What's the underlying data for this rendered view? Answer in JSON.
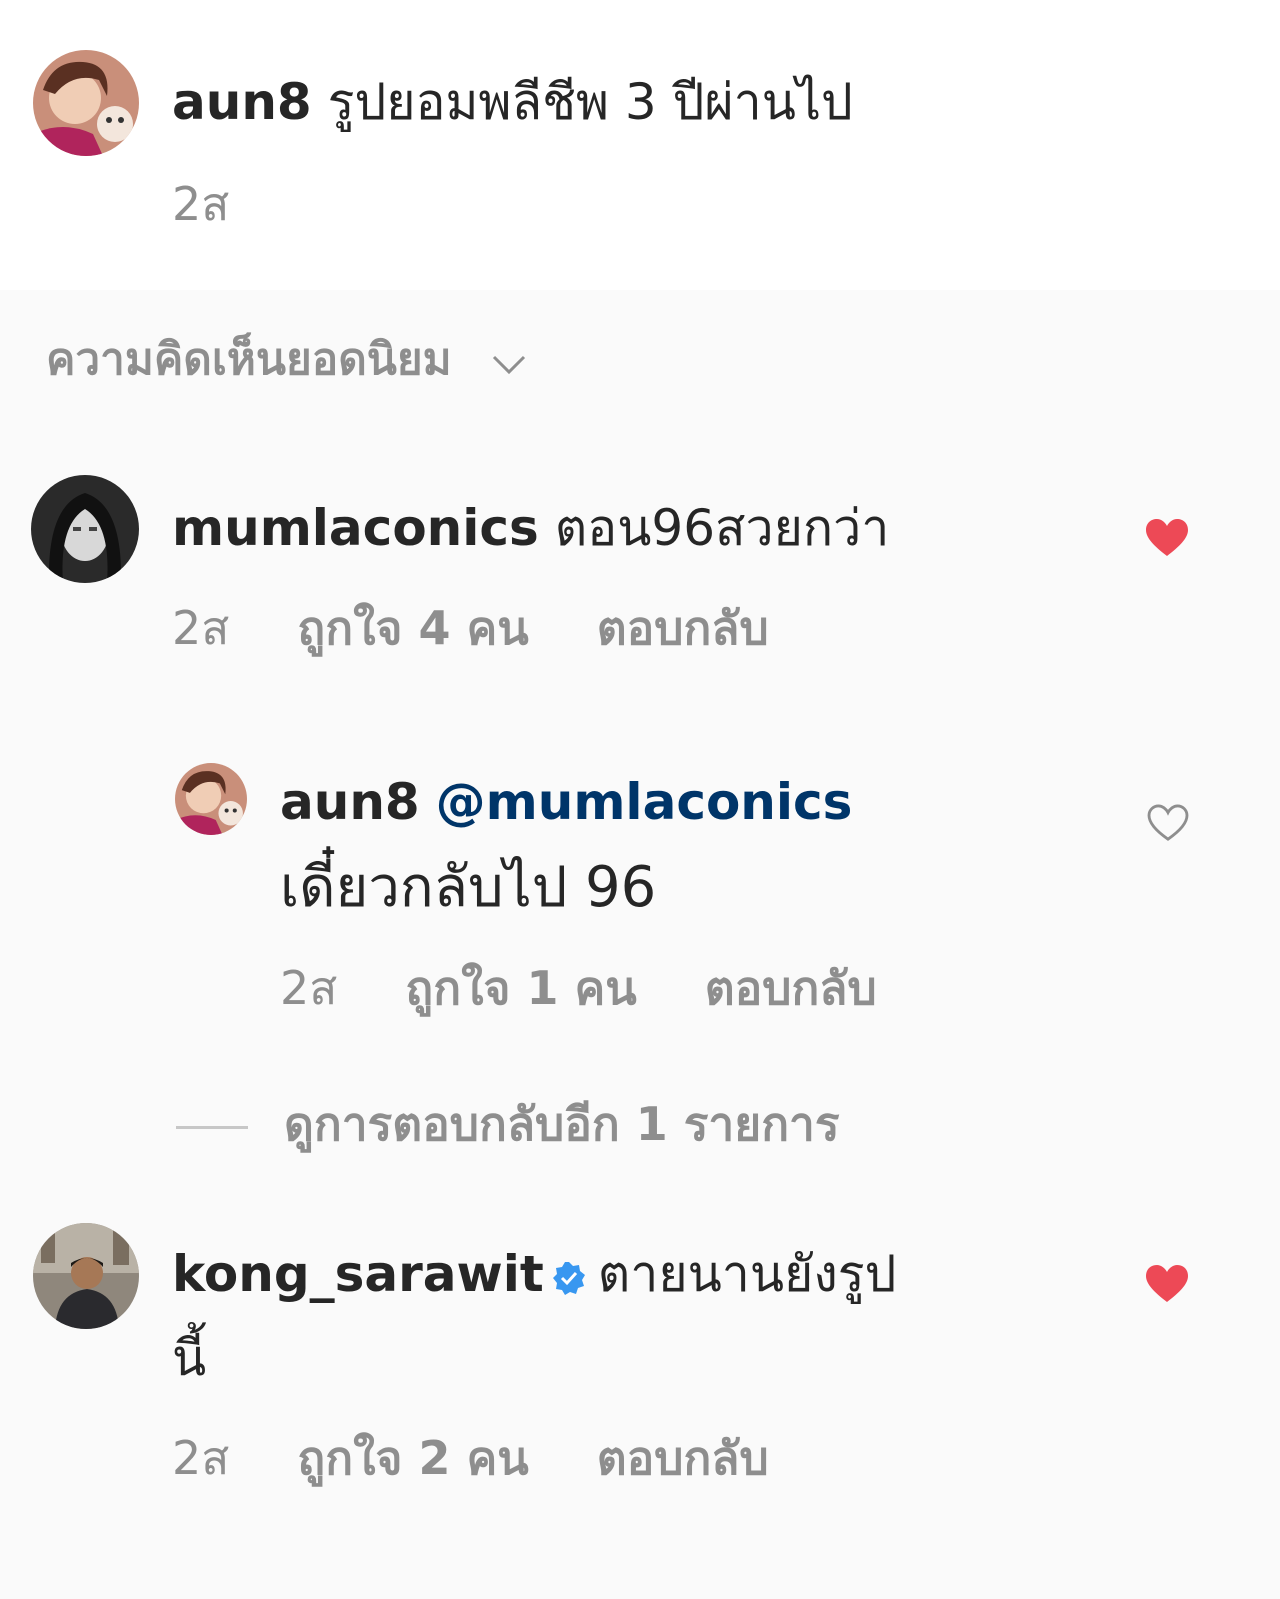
{
  "caption": {
    "username": "aun8",
    "text": "รูปยอมพลีชีพ 3 ปีผ่านไป",
    "time": "2ส"
  },
  "sort": {
    "label": "ความคิดเห็นยอดนิยม",
    "icon": "chevron-down-icon"
  },
  "comments": [
    {
      "username": "mumlaconics",
      "text": "ตอน96สวยกว่า",
      "time": "2ส",
      "likes": "ถูกใจ 4 คน",
      "reply": "ตอบกลับ",
      "liked": true
    },
    {
      "username": "kong_sarawit",
      "verified": true,
      "text_line1": "ตายนานยังรูป",
      "text_line2": "นี้",
      "time": "2ส",
      "likes": "ถูกใจ 2 คน",
      "reply": "ตอบกลับ",
      "liked": true
    }
  ],
  "reply": {
    "username": "aun8",
    "mention": "@mumlaconics",
    "text": "เดี๋ยวกลับไป 96",
    "time": "2ส",
    "likes": "ถูกใจ 1 คน",
    "reply": "ตอบกลับ",
    "liked": false
  },
  "view_more_replies": "ดูการตอบกลับอีก 1 รายการ",
  "colors": {
    "heart_liked": "#ed4956",
    "mention": "#003569",
    "verified": "#3897f0",
    "meta_text": "#8e8e8e"
  }
}
